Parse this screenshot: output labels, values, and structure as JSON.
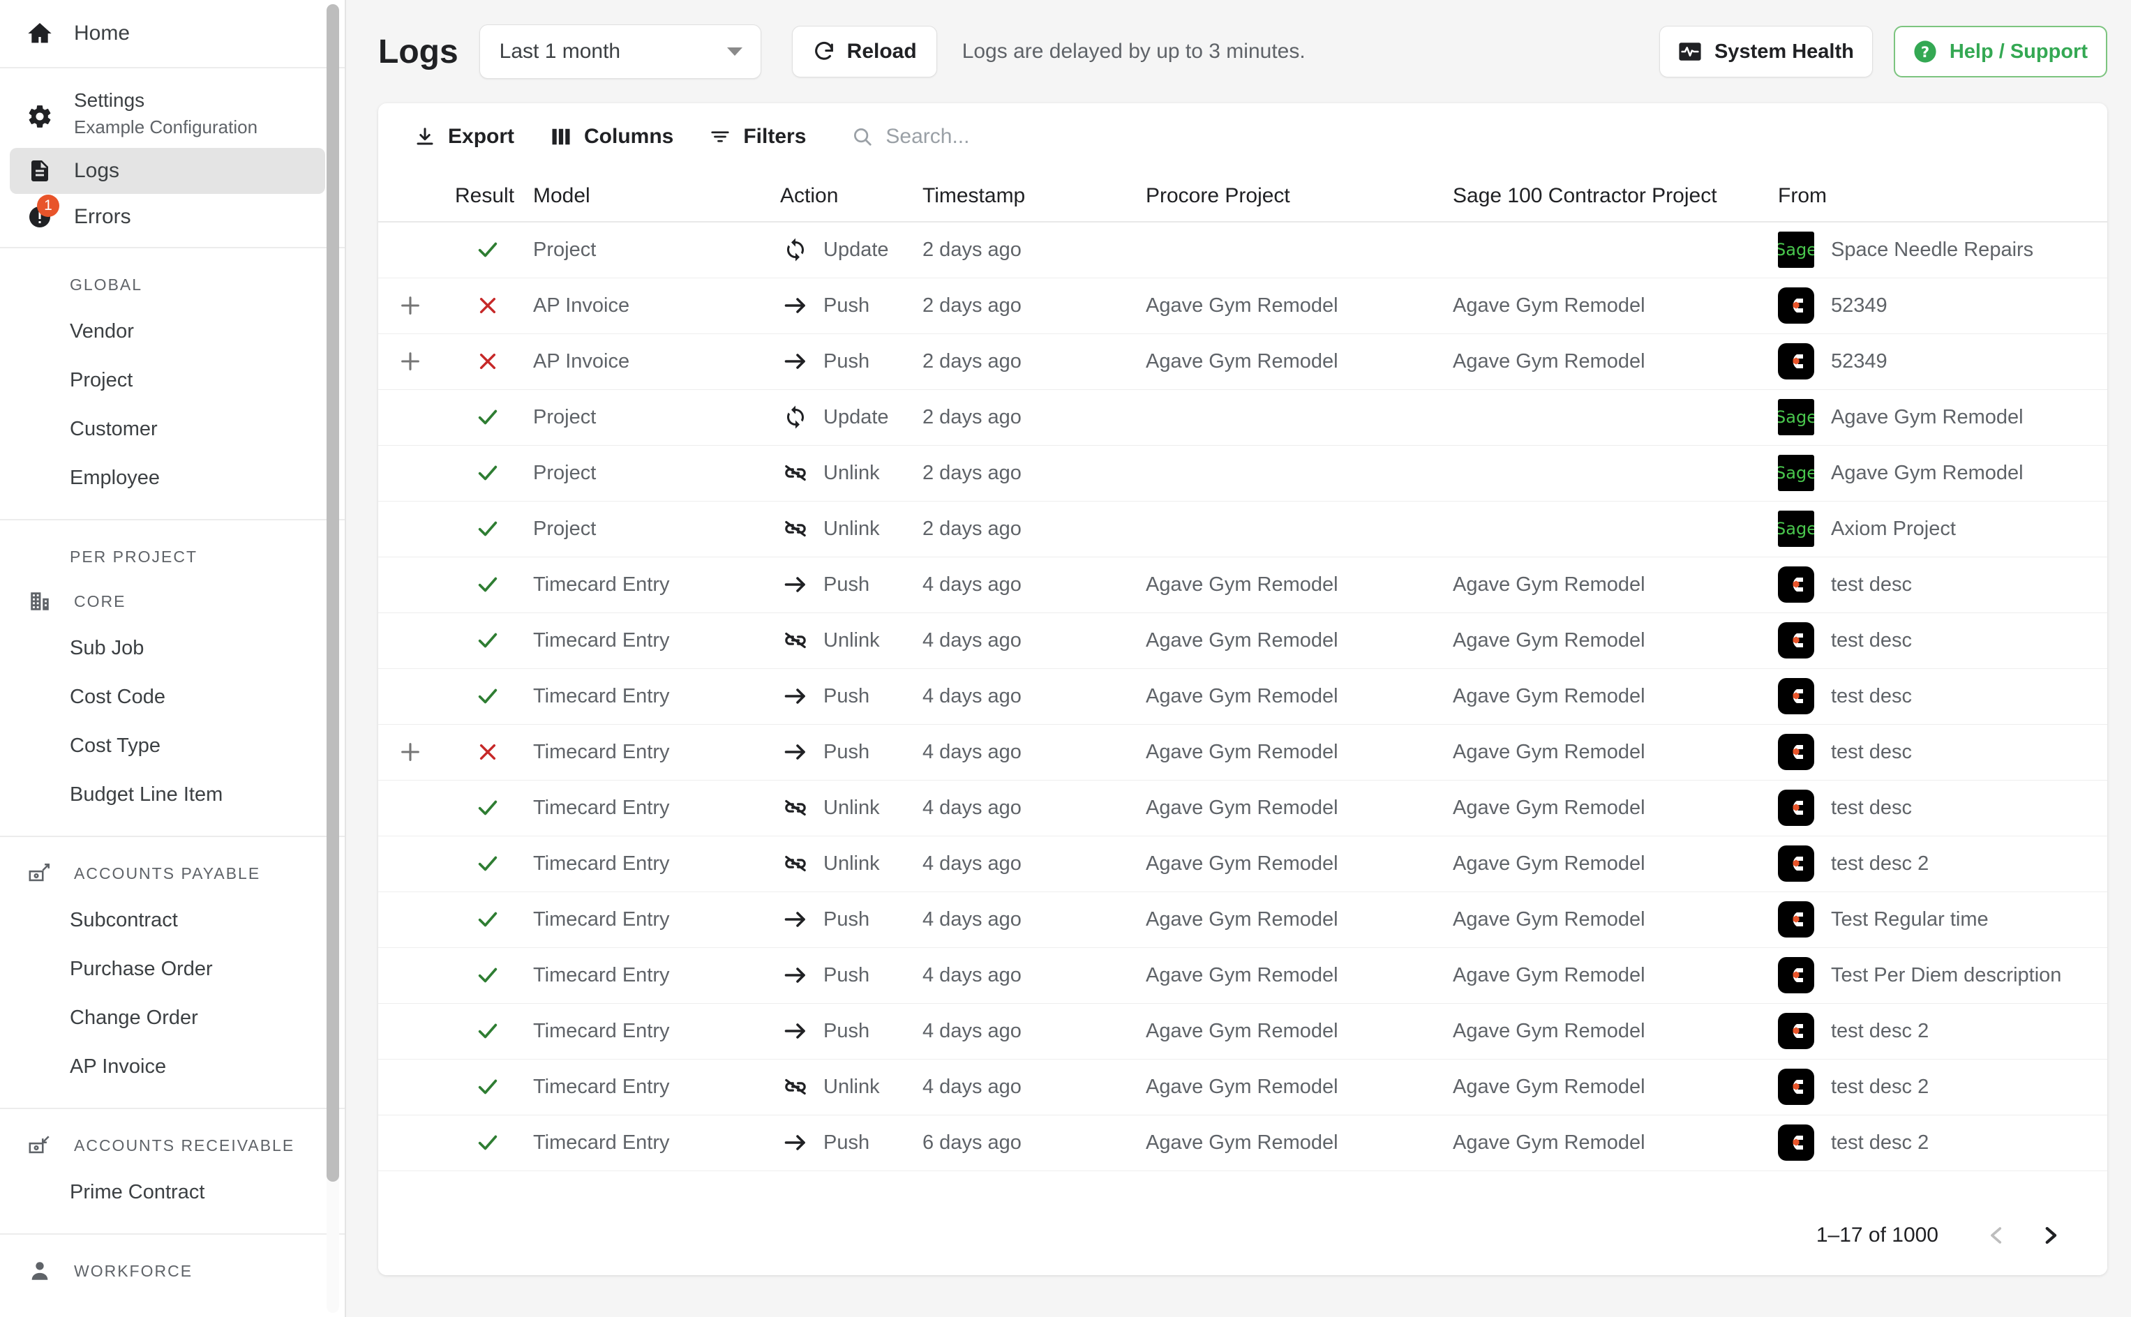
{
  "sidebar": {
    "home": {
      "label": "Home",
      "icon": "home-icon"
    },
    "settings": {
      "label": "Settings",
      "sub_label": "Example Configuration",
      "icon": "gear-icon"
    },
    "logs": {
      "label": "Logs",
      "icon": "document-icon"
    },
    "errors": {
      "label": "Errors",
      "icon": "error-icon",
      "badge": "1"
    },
    "global": {
      "heading": "GLOBAL",
      "items": [
        {
          "label": "Vendor"
        },
        {
          "label": "Project"
        },
        {
          "label": "Customer"
        },
        {
          "label": "Employee"
        }
      ]
    },
    "per_project": {
      "heading": "PER PROJECT",
      "groups": [
        {
          "heading": "CORE",
          "icon": "building-icon",
          "items": [
            {
              "label": "Sub Job"
            },
            {
              "label": "Cost Code"
            },
            {
              "label": "Cost Type"
            },
            {
              "label": "Budget Line Item"
            }
          ]
        },
        {
          "heading": "ACCOUNTS PAYABLE",
          "icon": "money-out-icon",
          "items": [
            {
              "label": "Subcontract"
            },
            {
              "label": "Purchase Order"
            },
            {
              "label": "Change Order"
            },
            {
              "label": "AP Invoice"
            }
          ]
        },
        {
          "heading": "ACCOUNTS RECEIVABLE",
          "icon": "money-in-icon",
          "items": [
            {
              "label": "Prime Contract"
            }
          ]
        },
        {
          "heading": "WORKFORCE",
          "icon": "person-icon",
          "items": []
        }
      ]
    }
  },
  "header": {
    "title": "Logs",
    "date_range": {
      "value": "Last 1 month"
    },
    "reload_label": "Reload",
    "delay_note": "Logs are delayed by up to 3 minutes.",
    "system_health_label": "System Health",
    "help_support_label": "Help / Support",
    "help_accent_color": "#34a853"
  },
  "toolbar": {
    "export_label": "Export",
    "columns_label": "Columns",
    "filters_label": "Filters",
    "search_placeholder": "Search...",
    "search_value": ""
  },
  "table": {
    "columns": [
      "",
      "Result",
      "Model",
      "Action",
      "Timestamp",
      "Procore Project",
      "Sage 100 Contractor Project",
      "From"
    ],
    "rows": [
      {
        "expand": "",
        "result": "success",
        "model": "Project",
        "action": "Update",
        "action_icon": "sync-icon",
        "timestamp": "2 days ago",
        "procore_project": "",
        "sage_project": "",
        "from_logo": "sage",
        "from": "Space Needle Repairs"
      },
      {
        "expand": "+",
        "result": "error",
        "model": "AP Invoice",
        "action": "Push",
        "action_icon": "arrow-right-icon",
        "timestamp": "2 days ago",
        "procore_project": "Agave Gym Remodel",
        "sage_project": "Agave Gym Remodel",
        "from_logo": "procore",
        "from": "52349"
      },
      {
        "expand": "+",
        "result": "error",
        "model": "AP Invoice",
        "action": "Push",
        "action_icon": "arrow-right-icon",
        "timestamp": "2 days ago",
        "procore_project": "Agave Gym Remodel",
        "sage_project": "Agave Gym Remodel",
        "from_logo": "procore",
        "from": "52349"
      },
      {
        "expand": "",
        "result": "success",
        "model": "Project",
        "action": "Update",
        "action_icon": "sync-icon",
        "timestamp": "2 days ago",
        "procore_project": "",
        "sage_project": "",
        "from_logo": "sage",
        "from": "Agave Gym Remodel"
      },
      {
        "expand": "",
        "result": "success",
        "model": "Project",
        "action": "Unlink",
        "action_icon": "unlink-icon",
        "timestamp": "2 days ago",
        "procore_project": "",
        "sage_project": "",
        "from_logo": "sage",
        "from": "Agave Gym Remodel"
      },
      {
        "expand": "",
        "result": "success",
        "model": "Project",
        "action": "Unlink",
        "action_icon": "unlink-icon",
        "timestamp": "2 days ago",
        "procore_project": "",
        "sage_project": "",
        "from_logo": "sage",
        "from": "Axiom Project"
      },
      {
        "expand": "",
        "result": "success",
        "model": "Timecard Entry",
        "action": "Push",
        "action_icon": "arrow-right-icon",
        "timestamp": "4 days ago",
        "procore_project": "Agave Gym Remodel",
        "sage_project": "Agave Gym Remodel",
        "from_logo": "procore",
        "from": "test desc"
      },
      {
        "expand": "",
        "result": "success",
        "model": "Timecard Entry",
        "action": "Unlink",
        "action_icon": "unlink-icon",
        "timestamp": "4 days ago",
        "procore_project": "Agave Gym Remodel",
        "sage_project": "Agave Gym Remodel",
        "from_logo": "procore",
        "from": "test desc"
      },
      {
        "expand": "",
        "result": "success",
        "model": "Timecard Entry",
        "action": "Push",
        "action_icon": "arrow-right-icon",
        "timestamp": "4 days ago",
        "procore_project": "Agave Gym Remodel",
        "sage_project": "Agave Gym Remodel",
        "from_logo": "procore",
        "from": "test desc"
      },
      {
        "expand": "+",
        "result": "error",
        "model": "Timecard Entry",
        "action": "Push",
        "action_icon": "arrow-right-icon",
        "timestamp": "4 days ago",
        "procore_project": "Agave Gym Remodel",
        "sage_project": "Agave Gym Remodel",
        "from_logo": "procore",
        "from": "test desc"
      },
      {
        "expand": "",
        "result": "success",
        "model": "Timecard Entry",
        "action": "Unlink",
        "action_icon": "unlink-icon",
        "timestamp": "4 days ago",
        "procore_project": "Agave Gym Remodel",
        "sage_project": "Agave Gym Remodel",
        "from_logo": "procore",
        "from": "test desc"
      },
      {
        "expand": "",
        "result": "success",
        "model": "Timecard Entry",
        "action": "Unlink",
        "action_icon": "unlink-icon",
        "timestamp": "4 days ago",
        "procore_project": "Agave Gym Remodel",
        "sage_project": "Agave Gym Remodel",
        "from_logo": "procore",
        "from": "test desc 2"
      },
      {
        "expand": "",
        "result": "success",
        "model": "Timecard Entry",
        "action": "Push",
        "action_icon": "arrow-right-icon",
        "timestamp": "4 days ago",
        "procore_project": "Agave Gym Remodel",
        "sage_project": "Agave Gym Remodel",
        "from_logo": "procore",
        "from": "Test Regular time"
      },
      {
        "expand": "",
        "result": "success",
        "model": "Timecard Entry",
        "action": "Push",
        "action_icon": "arrow-right-icon",
        "timestamp": "4 days ago",
        "procore_project": "Agave Gym Remodel",
        "sage_project": "Agave Gym Remodel",
        "from_logo": "procore",
        "from": "Test Per Diem description"
      },
      {
        "expand": "",
        "result": "success",
        "model": "Timecard Entry",
        "action": "Push",
        "action_icon": "arrow-right-icon",
        "timestamp": "4 days ago",
        "procore_project": "Agave Gym Remodel",
        "sage_project": "Agave Gym Remodel",
        "from_logo": "procore",
        "from": "test desc 2"
      },
      {
        "expand": "",
        "result": "success",
        "model": "Timecard Entry",
        "action": "Unlink",
        "action_icon": "unlink-icon",
        "timestamp": "4 days ago",
        "procore_project": "Agave Gym Remodel",
        "sage_project": "Agave Gym Remodel",
        "from_logo": "procore",
        "from": "test desc 2"
      },
      {
        "expand": "",
        "result": "success",
        "model": "Timecard Entry",
        "action": "Push",
        "action_icon": "arrow-right-icon",
        "timestamp": "6 days ago",
        "procore_project": "Agave Gym Remodel",
        "sage_project": "Agave Gym Remodel",
        "from_logo": "procore",
        "from": "test desc 2"
      }
    ]
  },
  "pagination": {
    "range_text": "1–17 of 1000",
    "prev_label": "‹",
    "next_label": "›"
  },
  "colors": {
    "success": "#2e7d32",
    "error": "#c62828",
    "badge": "#e8542a",
    "sage_green": "#49c64d",
    "procore_orange": "#e8542a"
  }
}
